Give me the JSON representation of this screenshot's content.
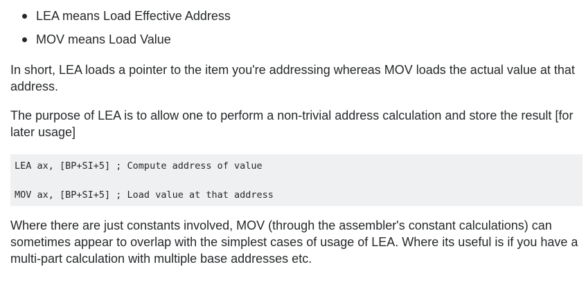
{
  "bullets": [
    "LEA means Load Effective Address",
    "MOV means Load Value"
  ],
  "paragraphs": {
    "p1": "In short, LEA loads a pointer to the item you're addressing whereas MOV loads the actual value at that address.",
    "p2": "The purpose of LEA is to allow one to perform a non-trivial address calculation and store the result [for later usage]",
    "p3": "Where there are just constants involved, MOV (through the assembler's constant calculations) can sometimes appear to overlap with the simplest cases of usage of LEA. Where its useful is if you have a multi-part calculation with multiple base addresses etc."
  },
  "code": {
    "line1": "LEA ax, [BP+SI+5] ; Compute address of value",
    "line2": "MOV ax, [BP+SI+5] ; Load value at that address"
  }
}
